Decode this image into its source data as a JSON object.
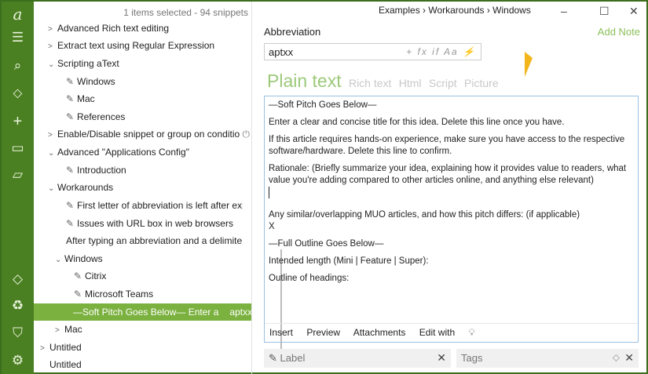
{
  "rail": {
    "icons": [
      "atext-logo-icon",
      "menu-icon",
      "search-icon",
      "tag-icon",
      "plus-icon",
      "new-folder-icon",
      "open-folder-icon",
      "diamond-icon",
      "recycle-icon",
      "shield-icon",
      "settings-icon"
    ]
  },
  "tree": {
    "count": "1 items selected - 94 snippets",
    "rows": [
      "Advanced Rich text editing",
      "Extract text using Regular Expression",
      "Scripting aText",
      "Windows",
      "Mac",
      "References",
      "Enable/Disable snippet or group on conditio",
      "Advanced \"Applications Config\"",
      "Introduction",
      "Workarounds",
      "First letter of abbreviation is left after expar",
      "Issues with URL box in web browsers",
      "After typing an abbreviation and a delimiter tc",
      "Windows",
      "Citrix",
      "Microsoft Teams",
      "—Soft Pitch Goes Below—  Enter a",
      "Mac",
      "Untitled",
      "Untitled"
    ],
    "selected_abbr": "aptxx"
  },
  "main": {
    "breadcrumb": "Examples › Workarounds › Windows",
    "abbreviation_label": "Abbreviation",
    "add_note": "Add Note",
    "abbreviation_value": "aptxx",
    "abbr_tools": "+ fx if Aa ⚡",
    "tabs": [
      "Plain text",
      "Rich text",
      "Html",
      "Script",
      "Picture"
    ],
    "content": [
      "—Soft Pitch Goes Below—",
      "Enter a clear and concise title for this idea. Delete this line once you have.",
      "If this article requires hands-on experience, make sure you have access to the respective software/hardware. Delete this line to confirm.",
      "Rationale: (Briefly summarize your idea, explaining how it provides value to readers, what value you're adding compared to other articles online, and anything else relevant)",
      "",
      "Any similar/overlapping MUO articles, and how this pitch differs: (if applicable)\nX",
      "—Full Outline Goes Below—",
      "Intended length (Mini | Feature | Super):",
      "Outline of headings:"
    ],
    "editor_toolbar": [
      "Insert",
      "Preview",
      "Attachments",
      "Edit with"
    ],
    "label_placeholder": "Label",
    "tags_placeholder": "Tags"
  }
}
